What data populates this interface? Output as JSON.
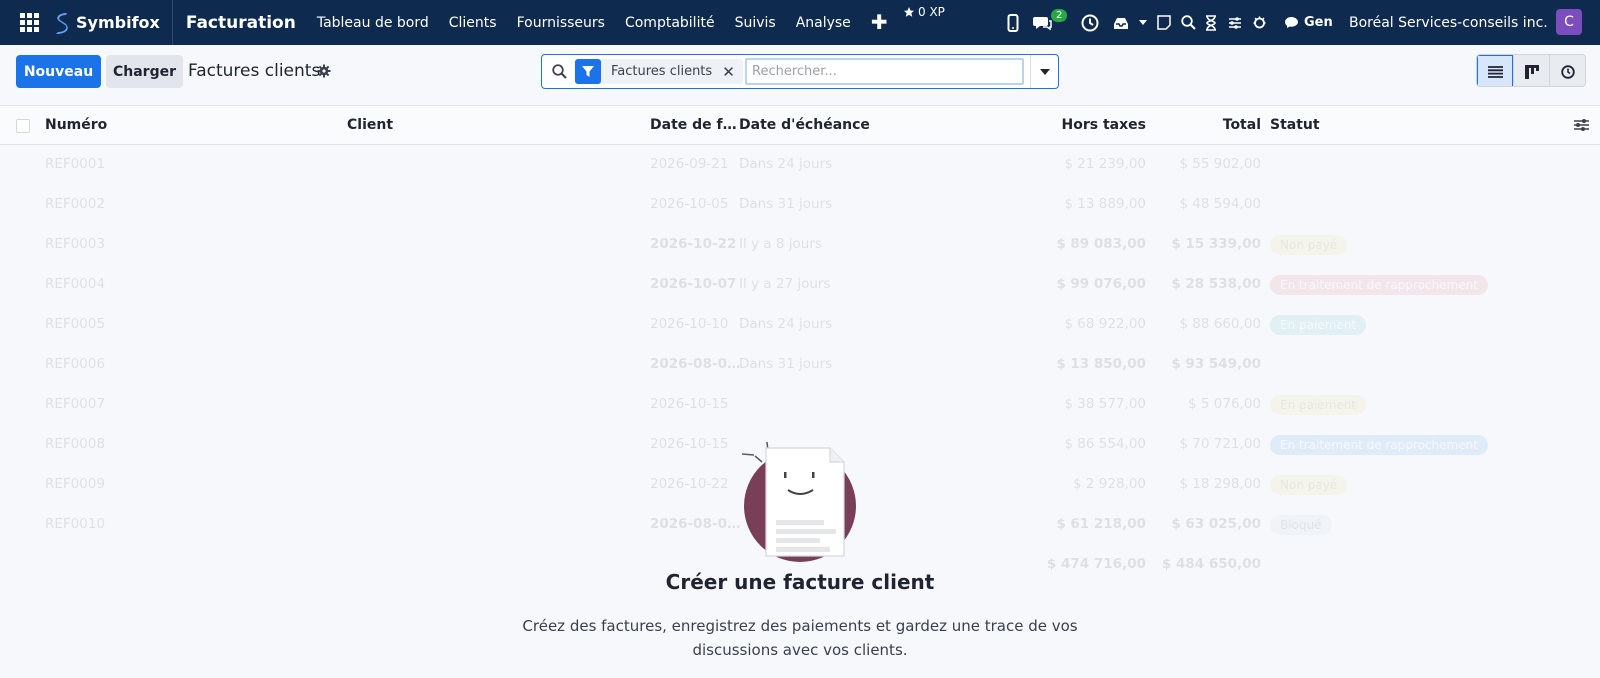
{
  "navbar": {
    "brand": "Symbifox",
    "app_name": "Facturation",
    "menu": [
      "Tableau de bord",
      "Clients",
      "Fournisseurs",
      "Comptabilité",
      "Suivis",
      "Analyse"
    ],
    "plus_icon": "plus-icon",
    "xp": "0 XP",
    "chat_count": "2",
    "gen": "Gen",
    "company": "Boréal Services-conseils inc.",
    "avatar_letter": "C",
    "avatar_color": "#7c4dbd"
  },
  "controls": {
    "new_label": "Nouveau",
    "load_label": "Charger",
    "title": "Factures clients"
  },
  "search": {
    "facet_label": "Factures clients",
    "placeholder": "Rechercher..."
  },
  "table": {
    "columns": {
      "numero": "Numéro",
      "client": "Client",
      "date_facture": "Date de f…",
      "date_echeance": "Date d'échéance",
      "hors_taxes": "Hors taxes",
      "total": "Total",
      "statut": "Statut"
    },
    "rows": [
      {
        "numero": "REF0001",
        "date": "2026-09-21",
        "echeance": "Dans 24 jours",
        "ht": "$ 21 239,00",
        "total": "$ 55 902,00",
        "statut": ""
      },
      {
        "numero": "REF0002",
        "date": "2026-10-05",
        "echeance": "Dans 31 jours",
        "ht": "$ 13 889,00",
        "total": "$ 48 594,00",
        "statut": ""
      },
      {
        "numero": "REF0003",
        "date": "2026-10-22",
        "echeance": "Il y a 8 jours",
        "ht": "$ 89 083,00",
        "total": "$ 15 339,00",
        "statut": "Non payé"
      },
      {
        "numero": "REF0004",
        "date": "2026-10-07",
        "echeance": "Il y a 27 jours",
        "ht": "$ 99 076,00",
        "total": "$ 28 538,00",
        "statut": "En traitement de rapprochement"
      },
      {
        "numero": "REF0005",
        "date": "2026-10-10",
        "echeance": "Dans 24 jours",
        "ht": "$ 68 922,00",
        "total": "$ 88 660,00",
        "statut": "En paiement"
      },
      {
        "numero": "REF0006",
        "date": "2026-08-0…",
        "echeance": "Dans 31 jours",
        "ht": "$ 13 850,00",
        "total": "$ 93 549,00",
        "statut": ""
      },
      {
        "numero": "REF0007",
        "date": "2026-10-15",
        "echeance": "",
        "ht": "$ 38 577,00",
        "total": "$ 5 076,00",
        "statut": "En paiement"
      },
      {
        "numero": "REF0008",
        "date": "2026-10-15",
        "echeance": "",
        "ht": "$ 86 554,00",
        "total": "$ 70 721,00",
        "statut": "En traitement de rapprochement"
      },
      {
        "numero": "REF0009",
        "date": "2026-10-22",
        "echeance": "",
        "ht": "$ 2 928,00",
        "total": "$ 18 298,00",
        "statut": "Non payé"
      },
      {
        "numero": "REF0010",
        "date": "2026-08-0…",
        "echeance": "",
        "ht": "$ 61 218,00",
        "total": "$ 63 025,00",
        "statut": "Bloqué"
      }
    ],
    "totals": {
      "ht": "$ 474 716,00",
      "total": "$ 484 650,00"
    }
  },
  "empty_state": {
    "title": "Créer une facture client",
    "line1": "Créez des factures, enregistrez des paiements et gardez une trace de vos",
    "line2": "discussions avec vos clients."
  },
  "colors": {
    "navbar": "#0e2a4f",
    "primary": "#1a73e8",
    "helper_circle": "#7a3f58"
  }
}
